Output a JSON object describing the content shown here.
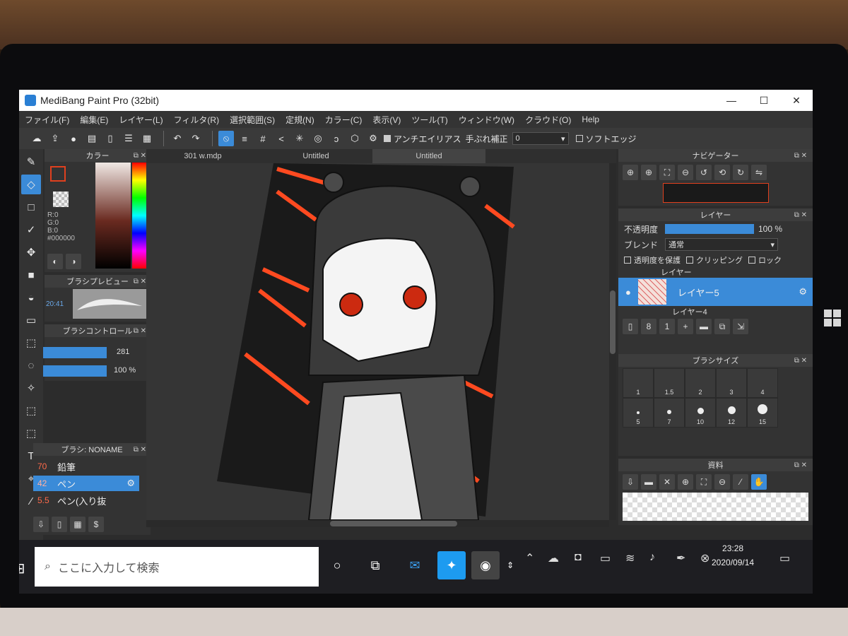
{
  "window": {
    "title": "MediBang Paint Pro (32bit)",
    "minimize": "—",
    "maximize": "☐",
    "close": "✕"
  },
  "menu": [
    "ファイル(F)",
    "編集(E)",
    "レイヤー(L)",
    "フィルタ(R)",
    "選択範囲(S)",
    "定規(N)",
    "カラー(C)",
    "表示(V)",
    "ツール(T)",
    "ウィンドウ(W)",
    "クラウド(O)",
    "Help"
  ],
  "toolbar": {
    "antialias_label": "アンチエイリアス",
    "stabilizer_label": "手ぶれ補正",
    "stabilizer_value": "0",
    "soft_edge_label": "ソフトエッジ"
  },
  "color_panel": {
    "title": "カラー",
    "r": "R:0",
    "g": "G:0",
    "b": "B:0",
    "hex": "#000000",
    "fg_color": "#e0401e"
  },
  "brush_preview": {
    "title": "ブラシプレビュー",
    "time": "20:41"
  },
  "brush_control": {
    "title": "ブラシコントロール",
    "size": "281",
    "opacity": "100 %"
  },
  "brush_list": {
    "title": "ブラシ: NONAME",
    "items": [
      {
        "size": "70",
        "name": "鉛筆"
      },
      {
        "size": "42",
        "name": "ペン"
      },
      {
        "size": "5.5",
        "name": "ペン(入り抜"
      }
    ]
  },
  "tabs": [
    "301 w.mdp",
    "Untitled",
    "Untitled"
  ],
  "navigator": {
    "title": "ナビゲーター"
  },
  "layer_panel": {
    "title": "レイヤー",
    "opacity_label": "不透明度",
    "opacity_value": "100 %",
    "opacity_fraction": 1.0,
    "blend_label": "ブレンド",
    "blend_value": "通常",
    "protect_alpha": "透明度を保護",
    "clipping": "クリッピング",
    "lock": "ロック",
    "layers": [
      {
        "name": "レイヤー"
      },
      {
        "name": "レイヤー5"
      },
      {
        "name": "レイヤー4"
      }
    ]
  },
  "brush_size": {
    "title": "ブラシサイズ",
    "sizes": [
      "1",
      "1.5",
      "2",
      "3",
      "4",
      "5",
      "7",
      "10",
      "12",
      "15"
    ]
  },
  "materials": {
    "title": "資料"
  },
  "taskbar": {
    "search_placeholder": "ここに入力して検索",
    "time": "23:28",
    "date": "2020/09/14"
  }
}
